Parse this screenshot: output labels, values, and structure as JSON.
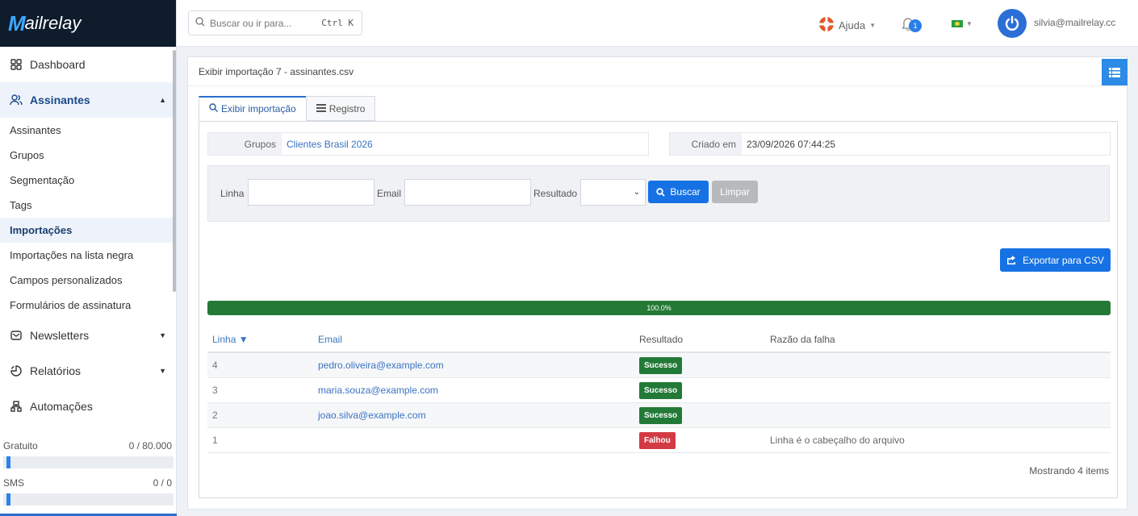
{
  "app": {
    "logo_mark": "M",
    "logo_text": "ailrelay"
  },
  "sidebar": {
    "items": [
      {
        "label": "Dashboard"
      },
      {
        "label": "Assinantes"
      },
      {
        "label": "Newsletters"
      },
      {
        "label": "Relatórios"
      },
      {
        "label": "Automações"
      }
    ],
    "subitems": [
      {
        "label": "Assinantes"
      },
      {
        "label": "Grupos"
      },
      {
        "label": "Segmentação"
      },
      {
        "label": "Tags"
      },
      {
        "label": "Importações"
      },
      {
        "label": "Importações na lista negra"
      },
      {
        "label": "Campos personalizados"
      },
      {
        "label": "Formulários de assinatura"
      }
    ],
    "quota": [
      {
        "label": "Gratuito",
        "value": "0 / 80.000"
      },
      {
        "label": "SMS",
        "value": "0 / 0"
      }
    ]
  },
  "header": {
    "search_placeholder": "Buscar ou ir para...",
    "search_shortcut": "Ctrl K",
    "help_label": "Ajuda",
    "notifications_count": "1",
    "user_email": "silvia@mailrelay.cc"
  },
  "page": {
    "title": "Exibir importação 7 - assinantes.csv",
    "tabs": [
      {
        "label": "Exibir importação"
      },
      {
        "label": "Registro"
      }
    ],
    "groups_label": "Grupos",
    "groups_value": "Clientes Brasil 2026",
    "created_label": "Criado em",
    "created_value": "23/09/2026 07:44:25"
  },
  "filters": {
    "line_label": "Linha",
    "email_label": "Email",
    "result_label": "Resultado",
    "search_button": "Buscar",
    "clear_button": "Limpar"
  },
  "export_button": "Exportar para CSV",
  "progress": {
    "value": 1.0,
    "label": "100.0%"
  },
  "table": {
    "headers": {
      "line": "Linha ▼",
      "email": "Email",
      "result": "Resultado",
      "reason": "Razão da falha"
    },
    "rows": [
      {
        "line": "4",
        "email": "pedro.oliveira@example.com",
        "result": "Sucesso",
        "reason": ""
      },
      {
        "line": "3",
        "email": "maria.souza@example.com",
        "result": "Sucesso",
        "reason": ""
      },
      {
        "line": "2",
        "email": "joao.silva@example.com",
        "result": "Sucesso",
        "reason": ""
      },
      {
        "line": "1",
        "email": "",
        "result": "Falhou",
        "reason": "Linha é o cabeçalho do arquivo"
      }
    ],
    "footer": "Mostrando 4 items"
  },
  "colors": {
    "primary": "#1672e4",
    "success": "#237a38",
    "danger": "#d23a44",
    "sidebar_dark": "#0e1c2c"
  }
}
